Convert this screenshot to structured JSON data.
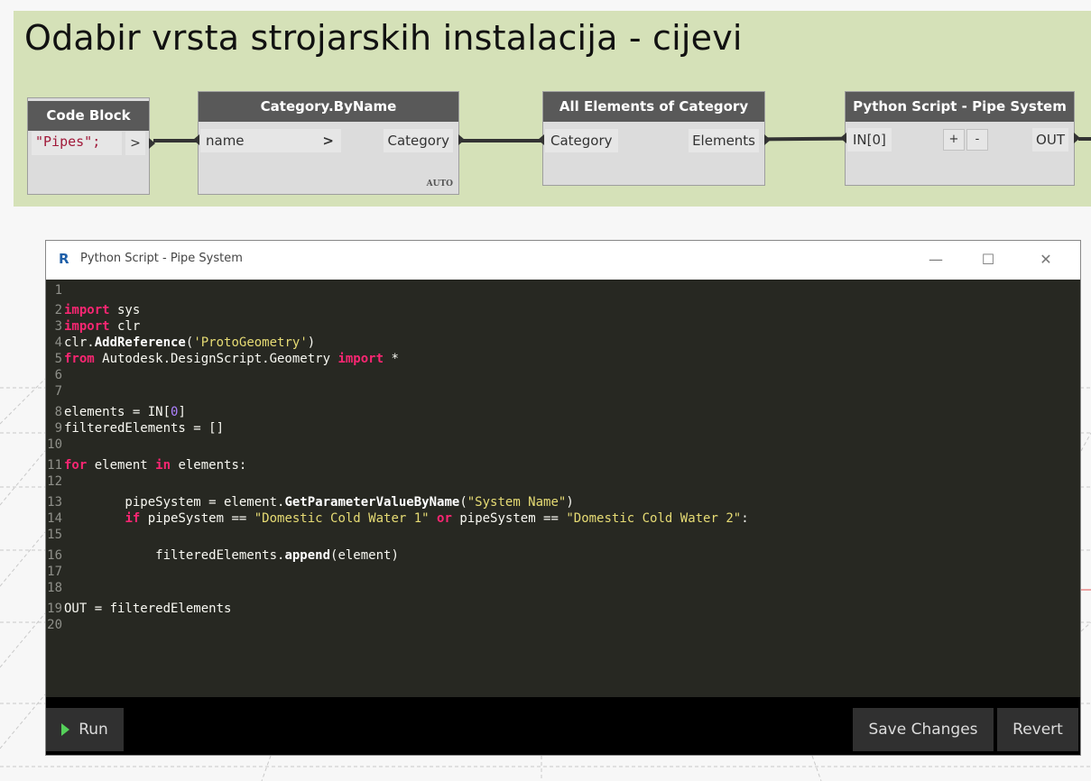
{
  "group": {
    "title": "Odabir vrsta strojarskih instalacija - cijevi",
    "color": "#d5e1b8"
  },
  "nodes": {
    "code_block": {
      "title": "Code Block",
      "code": "\"Pipes\";",
      "output_arrow": ">"
    },
    "category_by_name": {
      "title": "Category.ByName",
      "input": "name",
      "output": "Category",
      "lacing": "AUTO",
      "input_arrow": ">"
    },
    "all_elements": {
      "title": "All Elements of Category",
      "input": "Category",
      "output": "Elements"
    },
    "python_script": {
      "title": "Python Script - Pipe System",
      "input": "IN[0]",
      "plus": "+",
      "minus": "-",
      "output": "OUT"
    }
  },
  "window": {
    "app_icon": "R",
    "title": "Python Script - Pipe System",
    "controls": {
      "minimize": "—",
      "maximize": "☐",
      "close": "✕"
    }
  },
  "editor": {
    "line_numbers": [
      "1",
      "2",
      "3",
      "4",
      "5",
      "6",
      "7",
      "8",
      "9",
      "10",
      "11",
      "12",
      "13",
      "14",
      "15",
      "16",
      "17",
      "18",
      "19",
      "20"
    ]
  },
  "footer": {
    "run_label": "Run",
    "save_label": "Save Changes",
    "revert_label": "Revert"
  },
  "colors": {
    "editor_bg": "#272822",
    "keyword": "#f92672",
    "string": "#e6db74",
    "number": "#ae81ff",
    "run_icon": "#55d05a",
    "node_header": "#595959"
  }
}
